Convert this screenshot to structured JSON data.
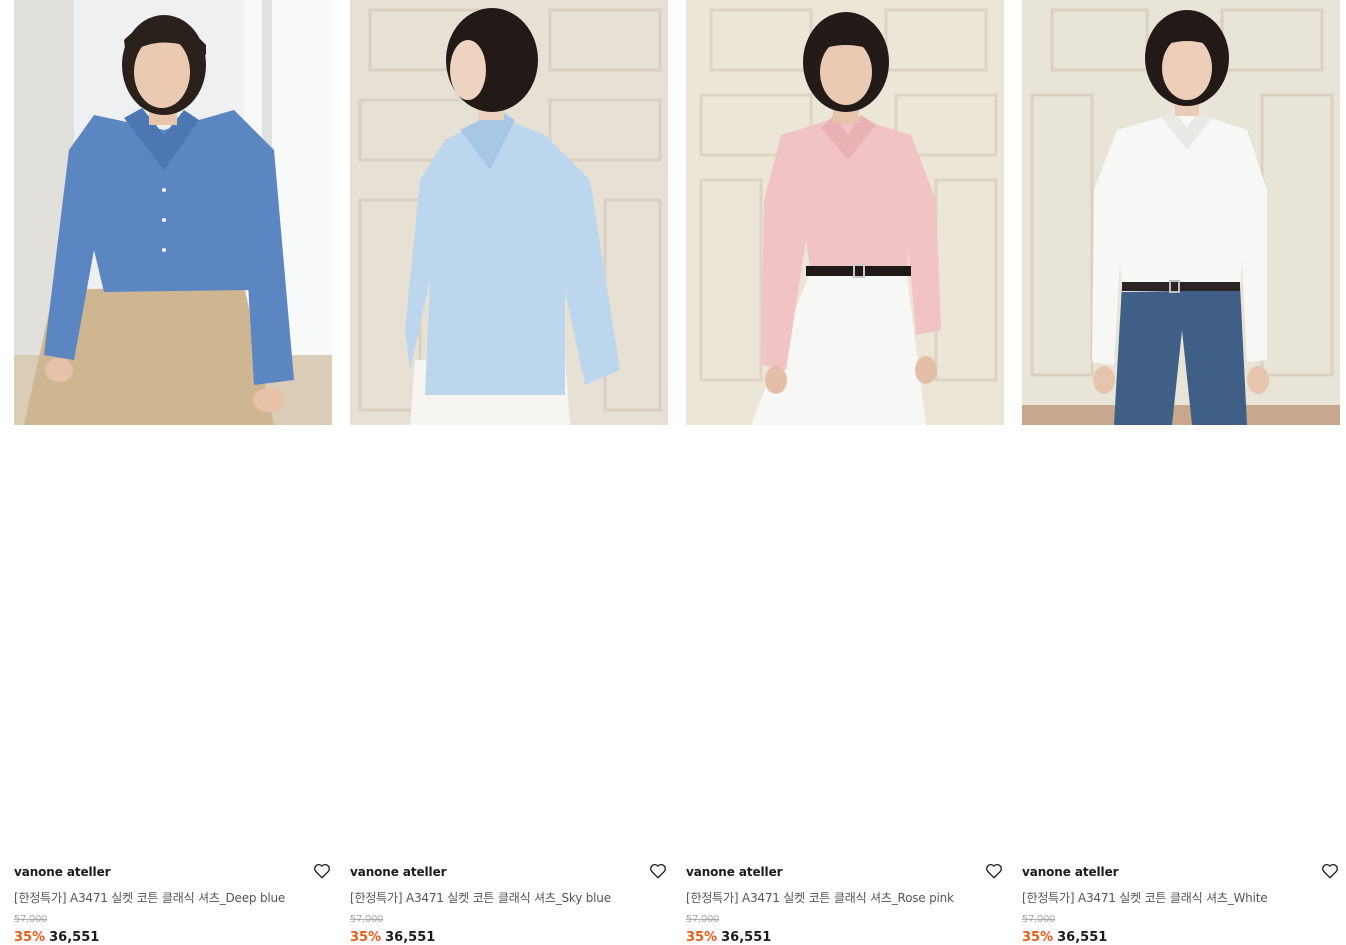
{
  "products": [
    {
      "brand": "vanone ateller",
      "name": "[한정특가] A3471 실켓 코튼 클래식 셔츠_Deep blue",
      "original_price": "57,000",
      "discount": "35%",
      "price": "36,551",
      "shirt_color": "#5b86c2",
      "bottom_color": "#cdb691",
      "bg_color": "#eef0f1",
      "wish_icon": "heart-outline-icon"
    },
    {
      "brand": "vanone ateller",
      "name": "[한정특가] A3471 실켓 코튼 클래식 셔츠_Sky blue",
      "original_price": "57,000",
      "discount": "35%",
      "price": "36,551",
      "shirt_color": "#bcd6ee",
      "bottom_color": "#f6f5f2",
      "bg_color": "#e7e0d4",
      "wish_icon": "heart-outline-icon"
    },
    {
      "brand": "vanone ateller",
      "name": "[한정특가] A3471 실켓 코튼 클래식 셔츠_Rose pink",
      "original_price": "57,000",
      "discount": "35%",
      "price": "36,551",
      "shirt_color": "#f2c3c5",
      "bottom_color": "#f7f7f6",
      "bg_color": "#ece6d9",
      "wish_icon": "heart-outline-icon"
    },
    {
      "brand": "vanone ateller",
      "name": "[한정특가] A3471 실켓 코튼 클래식 셔츠_White",
      "original_price": "57,000",
      "discount": "35%",
      "price": "36,551",
      "shirt_color": "#f7f7f5",
      "bottom_color": "#3f5f86",
      "bg_color": "#e9e4d8",
      "wish_icon": "heart-outline-icon"
    }
  ],
  "colors": {
    "discount": "#f05a1a",
    "price": "#1c1c1c",
    "original_price": "#aaaaaa"
  }
}
